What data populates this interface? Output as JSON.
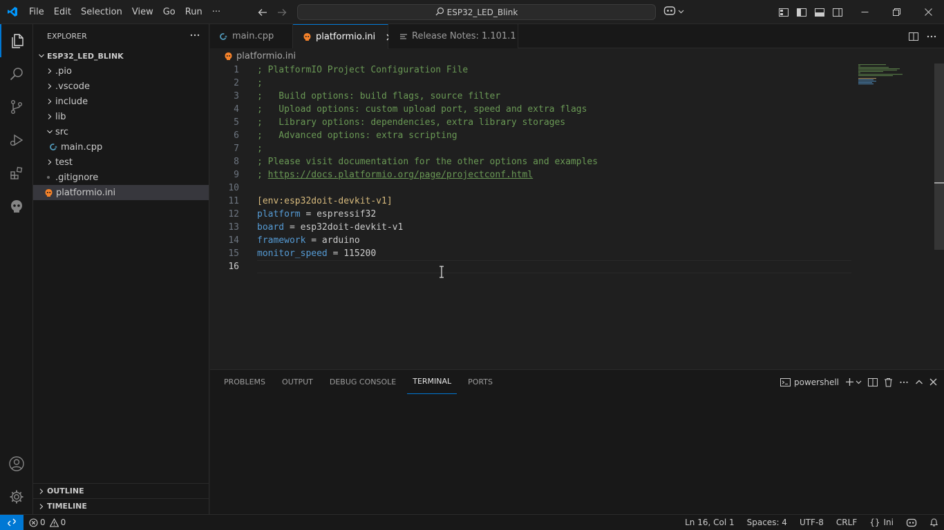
{
  "menu": [
    "File",
    "Edit",
    "Selection",
    "View",
    "Go",
    "Run",
    "···"
  ],
  "command_center": {
    "text": "ESP32_LED_Blink"
  },
  "explorer": {
    "title": "EXPLORER",
    "project": "ESP32_LED_BLINK",
    "items": [
      {
        "label": ".pio",
        "type": "folder",
        "expanded": false
      },
      {
        "label": ".vscode",
        "type": "folder",
        "expanded": false
      },
      {
        "label": "include",
        "type": "folder",
        "expanded": false
      },
      {
        "label": "lib",
        "type": "folder",
        "expanded": false
      },
      {
        "label": "src",
        "type": "folder",
        "expanded": true
      },
      {
        "label": "main.cpp",
        "type": "file-cpp"
      },
      {
        "label": "test",
        "type": "folder",
        "expanded": false
      },
      {
        "label": ".gitignore",
        "type": "file"
      },
      {
        "label": "platformio.ini",
        "type": "file-ini",
        "selected": true
      }
    ],
    "outline": "OUTLINE",
    "timeline": "TIMELINE"
  },
  "tabs": [
    {
      "label": "main.cpp",
      "active": false
    },
    {
      "label": "platformio.ini",
      "active": true
    },
    {
      "label": "Release Notes: 1.101.1",
      "active": false
    }
  ],
  "breadcrumb": "platformio.ini",
  "code_lines": [
    {
      "n": "1",
      "text": "; PlatformIO Project Configuration File"
    },
    {
      "n": "2",
      "text": ";"
    },
    {
      "n": "3",
      "text": ";   Build options: build flags, source filter"
    },
    {
      "n": "4",
      "text": ";   Upload options: custom upload port, speed and extra flags"
    },
    {
      "n": "5",
      "text": ";   Library options: dependencies, extra library storages"
    },
    {
      "n": "6",
      "text": ";   Advanced options: extra scripting"
    },
    {
      "n": "7",
      "text": ";"
    },
    {
      "n": "8",
      "text": "; Please visit documentation for the other options and examples"
    },
    {
      "n": "9",
      "prefix": "; ",
      "link": "https://docs.platformio.org/page/projectconf.html"
    },
    {
      "n": "10",
      "text": ""
    },
    {
      "n": "11",
      "section": "[env:esp32doit-devkit-v1]"
    },
    {
      "n": "12",
      "key": "platform",
      "value": " = espressif32"
    },
    {
      "n": "13",
      "key": "board",
      "value": " = esp32doit-devkit-v1"
    },
    {
      "n": "14",
      "key": "framework",
      "value": " = arduino"
    },
    {
      "n": "15",
      "key": "monitor_speed",
      "value": " = 115200"
    },
    {
      "n": "16",
      "text": ""
    }
  ],
  "panel": {
    "tabs": [
      "PROBLEMS",
      "OUTPUT",
      "DEBUG CONSOLE",
      "TERMINAL",
      "PORTS"
    ],
    "active_tab": "TERMINAL",
    "shell": "powershell"
  },
  "status": {
    "errors": "0",
    "warnings": "0",
    "position": "Ln 16, Col 1",
    "spaces": "Spaces: 4",
    "encoding": "UTF-8",
    "eol": "CRLF",
    "language": "Ini",
    "language_icon": "{}"
  },
  "colors": {
    "accent": "#0078d4",
    "comment": "#6a9955",
    "keyword": "#569cd6",
    "section": "#d7ba7d",
    "platformio_orange": "#f5822a"
  }
}
